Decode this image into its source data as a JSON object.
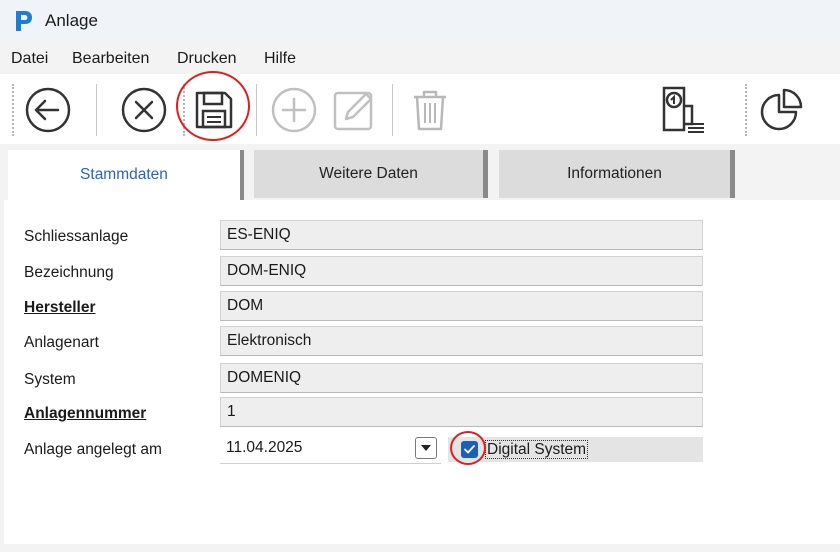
{
  "window": {
    "title": "Anlage"
  },
  "menu": [
    "Datei",
    "Bearbeiten",
    "Drucken",
    "Hilfe"
  ],
  "toolbar": {
    "buttons": [
      "back-icon",
      "cancel-icon",
      "save-icon",
      "add-icon",
      "edit-icon",
      "delete-icon",
      "cylinder-lock-icon",
      "pie-chart-icon"
    ]
  },
  "tabs": [
    "Stammdaten",
    "Weitere Daten",
    "Informationen"
  ],
  "form": {
    "rows": [
      {
        "label": "Schliessanlage",
        "value": "ES-ENIQ"
      },
      {
        "label": "Bezeichnung",
        "value": "DOM-ENIQ"
      },
      {
        "label": "Hersteller",
        "value": "DOM"
      },
      {
        "label": "Anlagenart",
        "value": "Elektronisch"
      },
      {
        "label": "System",
        "value": "DOMENIQ"
      },
      {
        "label": "Anlagennummer",
        "value": "1"
      }
    ],
    "date_label": "Anlage angelegt am",
    "date_value": "11.04.2025",
    "checkbox_label": "Digital System",
    "checkbox_checked": true
  },
  "colors": {
    "accent": "#2a63c4",
    "annotation": "#e01e1e",
    "checkbox": "#1c5fb4"
  }
}
